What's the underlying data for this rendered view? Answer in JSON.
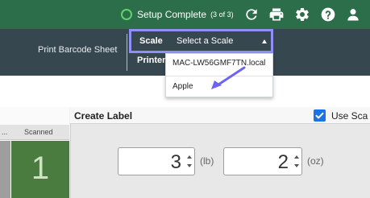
{
  "header": {
    "setup_label": "Setup Complete",
    "setup_count": "(3 of 3)",
    "icons": [
      "refresh-icon",
      "printer-icon",
      "gear-icon",
      "help-icon",
      "user-icon"
    ]
  },
  "toolbar": {
    "print_barcode_label": "Print Barcode Sheet",
    "scale_label": "Scale",
    "scale_select_value": "Select a Scale",
    "printer_label": "Printer"
  },
  "scale_dropdown": {
    "options": [
      "MAC-LW56GMF7TN.local",
      "Apple"
    ]
  },
  "table": {
    "columns": [
      "...",
      "Scanned"
    ],
    "scanned_value": "1"
  },
  "create_label": {
    "title": "Create Label",
    "use_scale_label": "Use Sca",
    "use_scale_checked": true,
    "pounds_value": "3",
    "pounds_unit": "(lb)",
    "ounces_value": "2",
    "ounces_unit": "(oz)"
  },
  "colors": {
    "header_green": "#2c6e49",
    "toolbar_slate": "#37474f",
    "highlight_purple": "#8f8ff5",
    "scanned_green": "#4a7c3f",
    "checkbox_blue": "#1a73e8"
  }
}
